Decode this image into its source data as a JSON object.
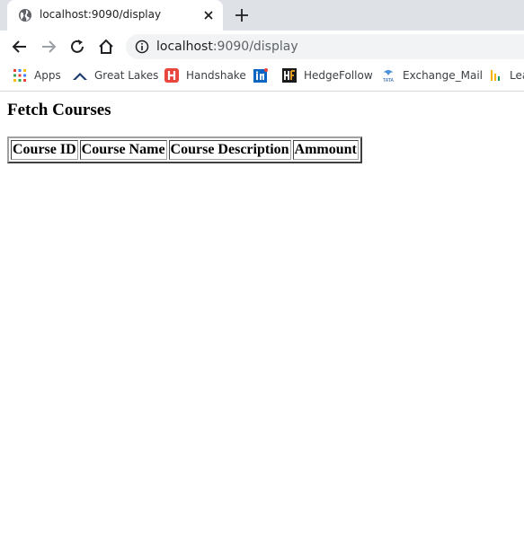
{
  "browser": {
    "tab": {
      "title": "localhost:9090/display"
    },
    "address": {
      "host": "localhost",
      "rest": ":9090/display"
    },
    "bookmarks": [
      {
        "label": "Apps",
        "icon": "apps-grid-icon"
      },
      {
        "label": "Great Lakes",
        "icon": "great-lakes-icon"
      },
      {
        "label": "Handshake",
        "icon": "handshake-icon"
      },
      {
        "label": "",
        "icon": "linkedin-icon"
      },
      {
        "label": "HedgeFollow",
        "icon": "hedgefollow-icon"
      },
      {
        "label": "Exchange_Mail",
        "icon": "tata-icon"
      },
      {
        "label": "Lea",
        "icon": "bar-chart-icon"
      }
    ]
  },
  "page": {
    "heading": "Fetch Courses",
    "table": {
      "columns": [
        "Course ID",
        "Course Name",
        "Course Description",
        "Ammount"
      ],
      "rows": []
    }
  },
  "colors": {
    "tabstrip": "#dee1e6",
    "omnibox": "#f1f3f4",
    "handshake_red": "#e8453c",
    "linkedin_blue": "#0a66c2"
  }
}
